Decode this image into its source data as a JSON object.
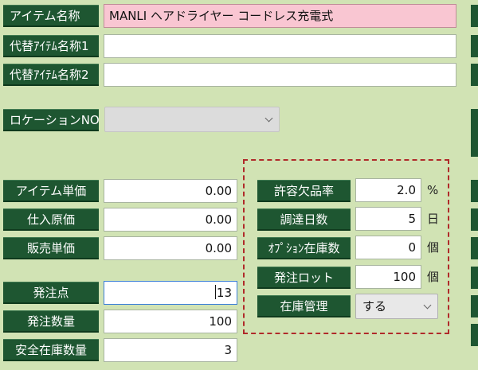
{
  "fields": {
    "item_name": {
      "label": "アイテム名称",
      "value": "MANLI ヘアドライヤー コードレス充電式"
    },
    "alt_name1": {
      "label": "代替ｱｲﾃﾑ名称1",
      "value": ""
    },
    "alt_name2": {
      "label": "代替ｱｲﾃﾑ名称2",
      "value": ""
    },
    "location": {
      "label": "ロケーションNO",
      "value": ""
    },
    "unit_price": {
      "label": "アイテム単価",
      "value": "0.00"
    },
    "purchase_cost": {
      "label": "仕入原価",
      "value": "0.00"
    },
    "sales_price": {
      "label": "販売単価",
      "value": "0.00"
    },
    "reorder_point": {
      "label": "発注点",
      "value": "13"
    },
    "order_qty": {
      "label": "発注数量",
      "value": "100"
    },
    "safety_stock": {
      "label": "安全在庫数量",
      "value": "3"
    },
    "shortage_rate": {
      "label": "許容欠品率",
      "value": "2.0",
      "unit": "%"
    },
    "lead_days": {
      "label": "調達日数",
      "value": "5",
      "unit": "日"
    },
    "option_stock": {
      "label": "ｵﾌﾟｼｮﾝ在庫数",
      "value": "0",
      "unit": "個"
    },
    "order_lot": {
      "label": "発注ロット",
      "value": "100",
      "unit": "個"
    },
    "stock_mgmt": {
      "label": "在庫管理",
      "value": "する"
    }
  },
  "colors": {
    "background": "#d1e3b4",
    "label_bg": "#1e5631",
    "label_text": "#ffffff",
    "highlight_field": "#f9c6d2",
    "dashed_border": "#b02a2a"
  },
  "icons": {
    "select_arrow": "chevron-down-icon"
  }
}
